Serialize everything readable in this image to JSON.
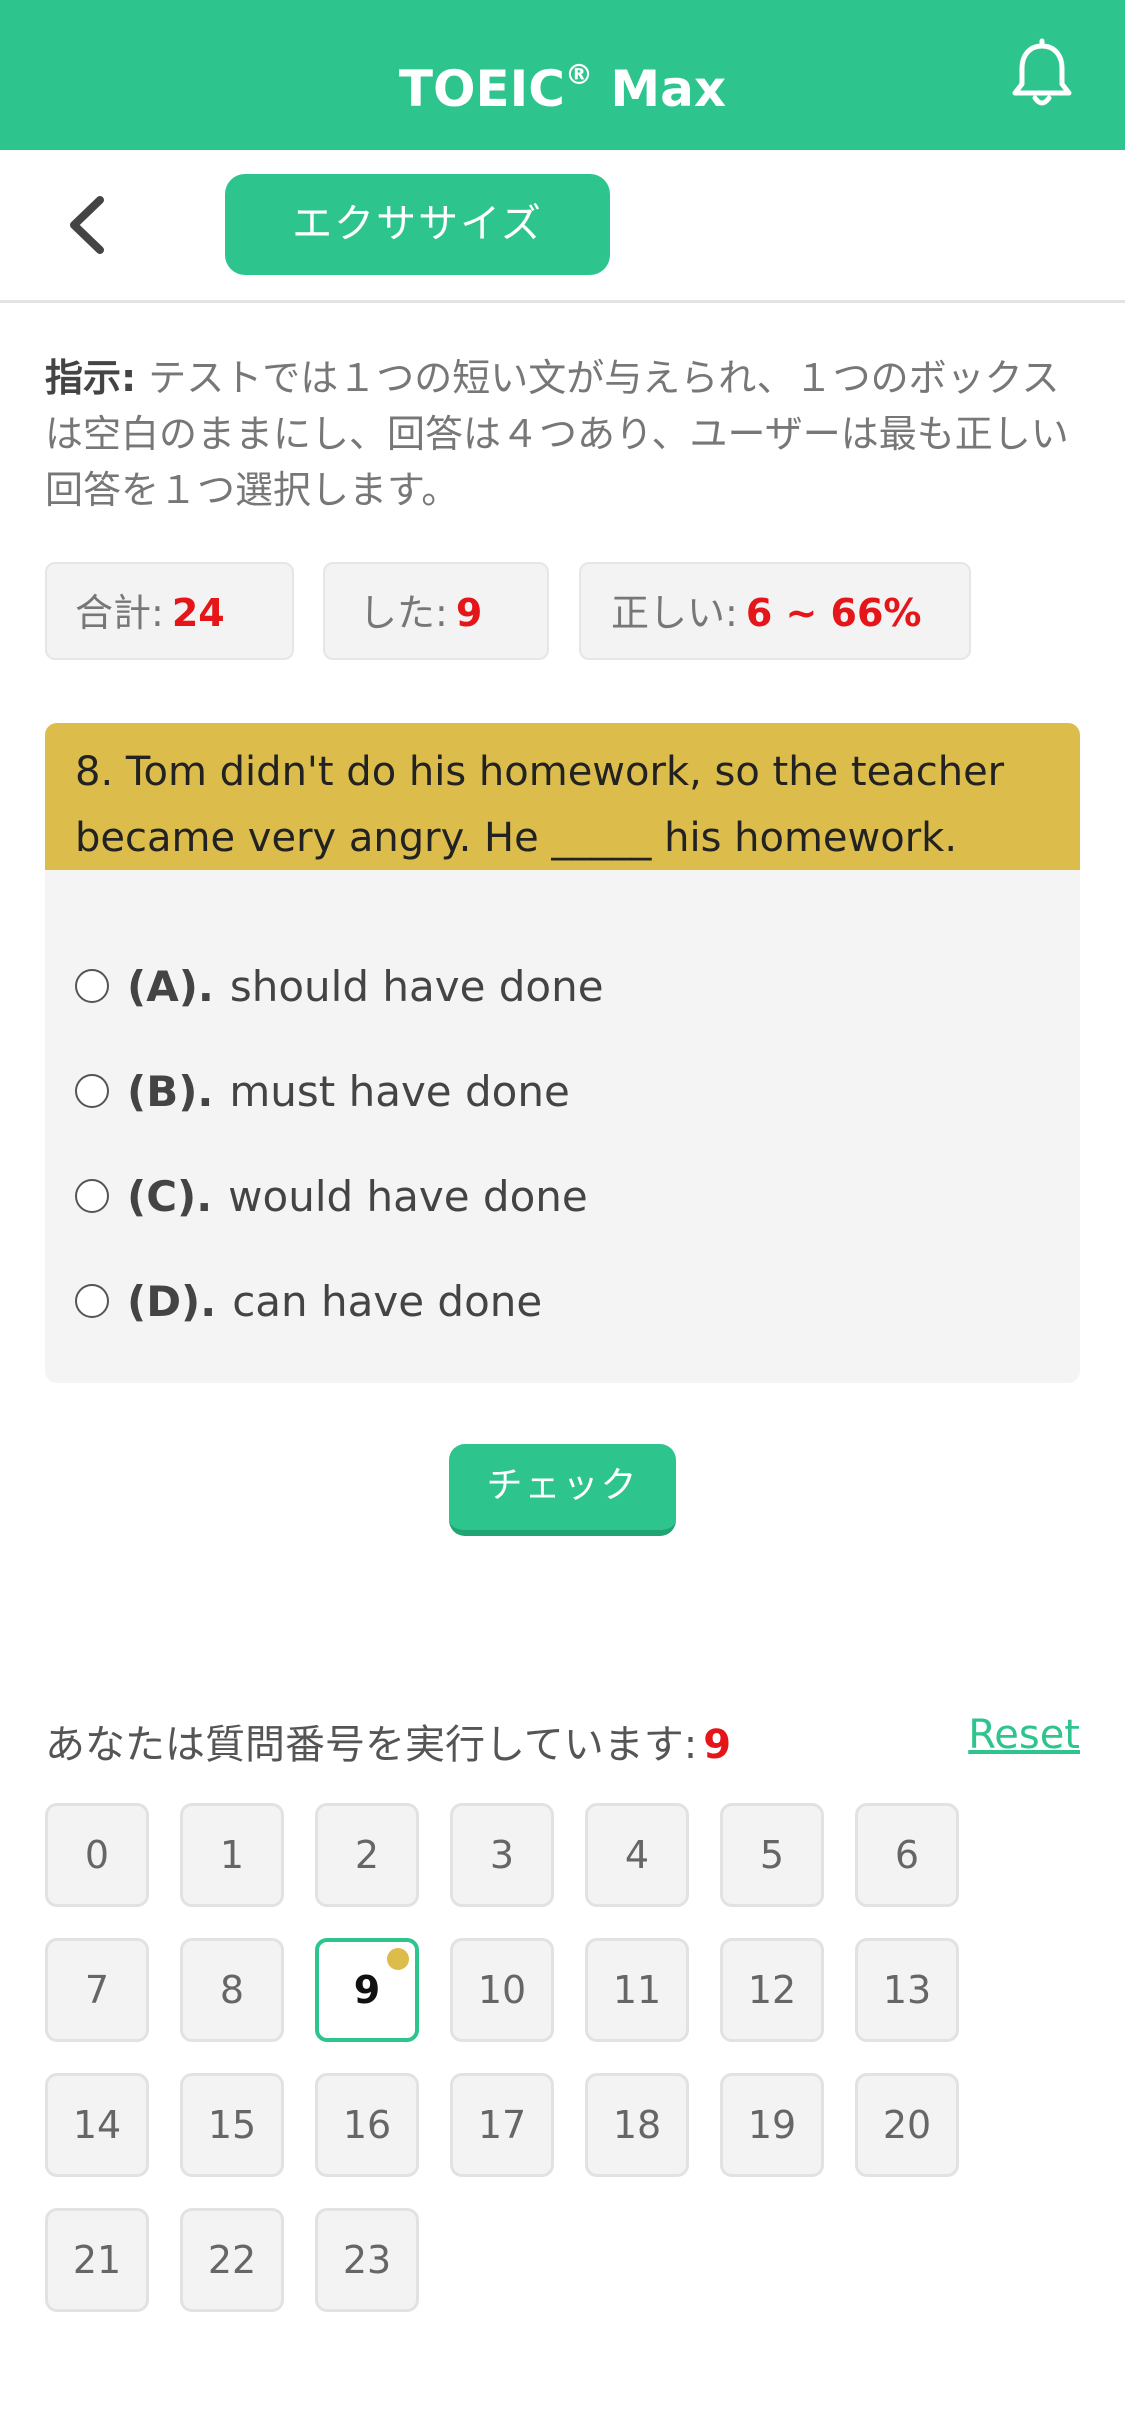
{
  "header": {
    "title_main": "TOEIC",
    "title_reg": "®",
    "title_rest": " Max",
    "bell_icon": "bell-icon"
  },
  "subbar": {
    "back_icon": "chevron-left-icon",
    "tab_label": "エクササイズ"
  },
  "instructions": {
    "label": "指示:",
    "text": " テストでは１つの短い文が与えられ、１つのボックスは空白のままにし、回答は４つあり、ユーザーは最も正しい回答を１つ選択します。"
  },
  "stats": {
    "total_label": "合計:",
    "total_value": "24",
    "done_label": "した:",
    "done_value": "9",
    "correct_label": "正しい:",
    "correct_value": "6 ~ 66%"
  },
  "question": {
    "text": "8. Tom didn't do his homework, so the teacher became very angry. He _____ his homework.",
    "options": [
      {
        "letter": "(A).",
        "text": "should have done"
      },
      {
        "letter": "(B).",
        "text": "must have done"
      },
      {
        "letter": "(C).",
        "text": "would have done"
      },
      {
        "letter": "(D).",
        "text": "can have done"
      }
    ]
  },
  "check_button": "チェック",
  "progress": {
    "label": "あなたは質問番号を実行しています:",
    "current": "9",
    "reset": "Reset"
  },
  "question_numbers": [
    "0",
    "1",
    "2",
    "3",
    "4",
    "5",
    "6",
    "7",
    "8",
    "9",
    "10",
    "11",
    "12",
    "13",
    "14",
    "15",
    "16",
    "17",
    "18",
    "19",
    "20",
    "21",
    "22",
    "23"
  ],
  "colors": {
    "primary": "#2dc48d",
    "question_header": "#dcbd4c",
    "accent_red": "#e5161a"
  }
}
